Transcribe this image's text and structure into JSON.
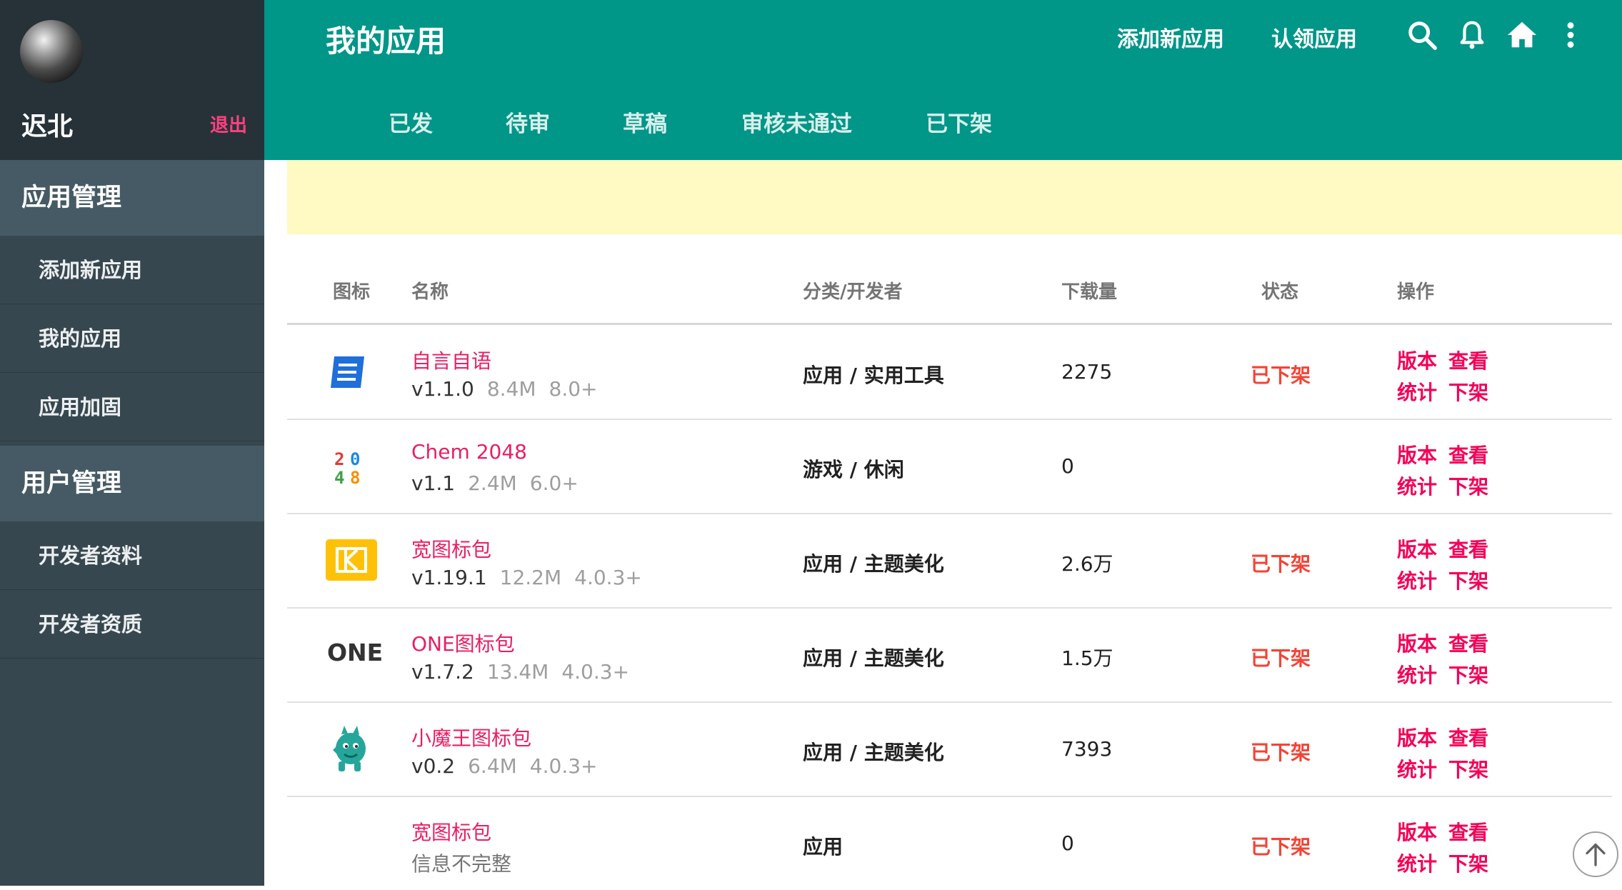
{
  "user": {
    "name": "迟北",
    "logout_label": "退出"
  },
  "sidebar": {
    "sections": [
      {
        "title": "应用管理",
        "items": [
          "添加新应用",
          "我的应用",
          "应用加固"
        ]
      },
      {
        "title": "用户管理",
        "items": [
          "开发者资料",
          "开发者资质"
        ]
      }
    ]
  },
  "header": {
    "title": "我的应用",
    "links": [
      "添加新应用",
      "认领应用"
    ],
    "icons": [
      "search-icon",
      "bell-icon",
      "home-icon",
      "more-vert-icon"
    ],
    "tabs": [
      "已发",
      "待审",
      "草稿",
      "审核未通过",
      "已下架"
    ]
  },
  "table": {
    "headers": [
      "图标",
      "名称",
      "分类/开发者",
      "下载量",
      "状态",
      "操作"
    ],
    "actions": [
      "版本",
      "查看",
      "统计",
      "下架"
    ],
    "rows": [
      {
        "name": "自言自语",
        "version": "v1.1.0",
        "size": "8.4M",
        "android": "8.0+",
        "category": "应用 / 实用工具",
        "downloads": "2275",
        "status": "已下架",
        "icon": "document-icon"
      },
      {
        "name": "Chem 2048",
        "version": "v1.1",
        "size": "2.4M",
        "android": "6.0+",
        "category": "游戏 / 休闲",
        "downloads": "0",
        "status": "",
        "icon": "2048-icon"
      },
      {
        "name": "宽图标包",
        "version": "v1.19.1",
        "size": "12.2M",
        "android": "4.0.3+",
        "category": "应用 / 主题美化",
        "downloads": "2.6万",
        "status": "已下架",
        "icon": "k-icon"
      },
      {
        "name": "ONE图标包",
        "version": "v1.7.2",
        "size": "13.4M",
        "android": "4.0.3+",
        "category": "应用 / 主题美化",
        "downloads": "1.5万",
        "status": "已下架",
        "icon": "one-logo-icon",
        "icon_text": "ONE"
      },
      {
        "name": "小魔王图标包",
        "version": "v0.2",
        "size": "6.4M",
        "android": "4.0.3+",
        "category": "应用 / 主题美化",
        "downloads": "7393",
        "status": "已下架",
        "icon": "little-devil-icon"
      },
      {
        "name": "宽图标包",
        "info": "信息不完整",
        "category": "应用",
        "downloads": "0",
        "status": "已下架",
        "icon": ""
      }
    ]
  },
  "colors": {
    "header": "#009688",
    "sidebar": "#37474f",
    "accent": "#e91e63",
    "status": "#f44336"
  }
}
